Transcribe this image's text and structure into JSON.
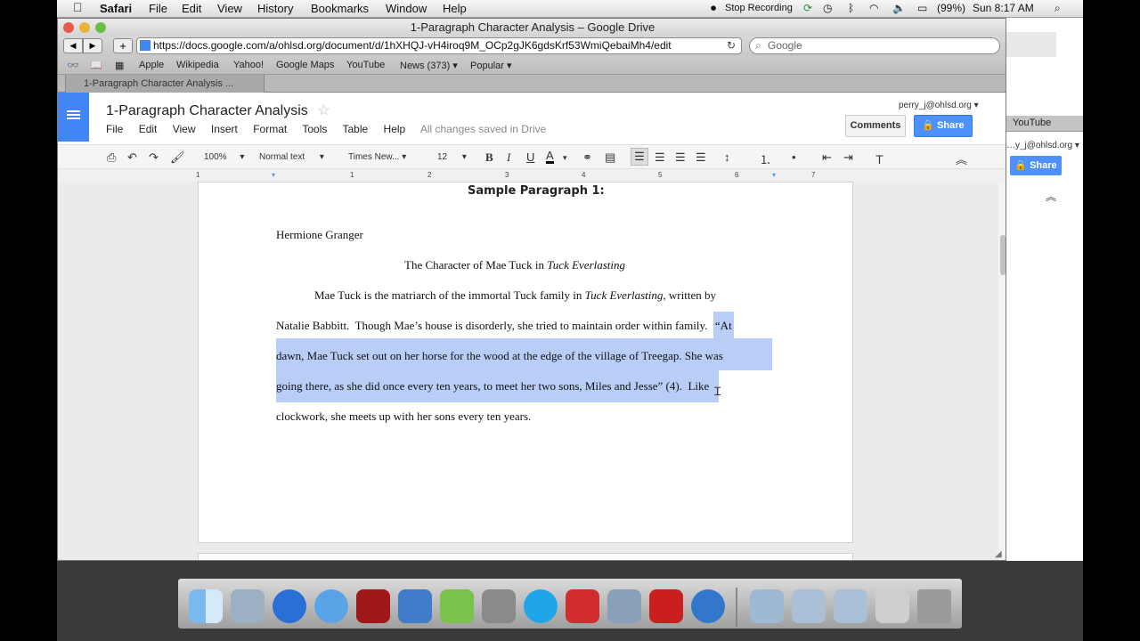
{
  "menubar": {
    "app": "Safari",
    "items": [
      "File",
      "Edit",
      "View",
      "History",
      "Bookmarks",
      "Window",
      "Help"
    ],
    "recording": "Stop Recording",
    "battery": "(99%)",
    "clock": "Sun 8:17 AM"
  },
  "window": {
    "title": "1-Paragraph Character Analysis – Google Drive",
    "url": "https://docs.google.com/a/ohlsd.org/document/d/1hXHQJ-vH4iroq9M_OCp2gJK6gdsKrf53WmiQebaiMh4/edit",
    "search_placeholder": "Google",
    "bookmarks": [
      "Apple",
      "Wikipedia",
      "Yahoo!",
      "Google Maps",
      "YouTube",
      "News (373) ▾",
      "Popular ▾"
    ],
    "tab": "1-Paragraph Character Analysis ..."
  },
  "docs": {
    "title": "1-Paragraph Character Analysis",
    "menu": [
      "File",
      "Edit",
      "View",
      "Insert",
      "Format",
      "Tools",
      "Table",
      "Help"
    ],
    "saved": "All changes saved in Drive",
    "user": "perry_j@ohlsd.org ▾",
    "comments": "Comments",
    "share": "Share",
    "zoom": "100%",
    "style": "Normal text",
    "font": "Times New...",
    "size": "12",
    "ruler": [
      "1",
      "1",
      "2",
      "3",
      "4",
      "5",
      "6",
      "7"
    ]
  },
  "document": {
    "heading": "Sample Paragraph 1:",
    "author": "Hermione Granger",
    "title_plain": "The Character of Mae Tuck in ",
    "title_italic": "Tuck Everlasting",
    "line1_a": "Mae Tuck is the matriarch of the immortal Tuck family in ",
    "line1_b": "Tuck Everlasting",
    "line1_c": ", written by",
    "line2_a": "Natalie Babbitt.  Though Mae’s house is disorderly, she tried to maintain order within family.  ",
    "line2_b": "“At",
    "line3": "dawn, Mae Tuck set out on her horse for the wood at the edge of the village of Treegap.  She was",
    "line4_a": "going there, as she did once every ten years, to meet her two sons, Miles and Jesse” (4).",
    "line4_b": "  Like",
    "line5": "clockwork, she meets up with her sons every ten years."
  },
  "background_window": {
    "tab": "YouTube",
    "user": "…y_j@ohlsd.org ▾",
    "share": "Share"
  }
}
